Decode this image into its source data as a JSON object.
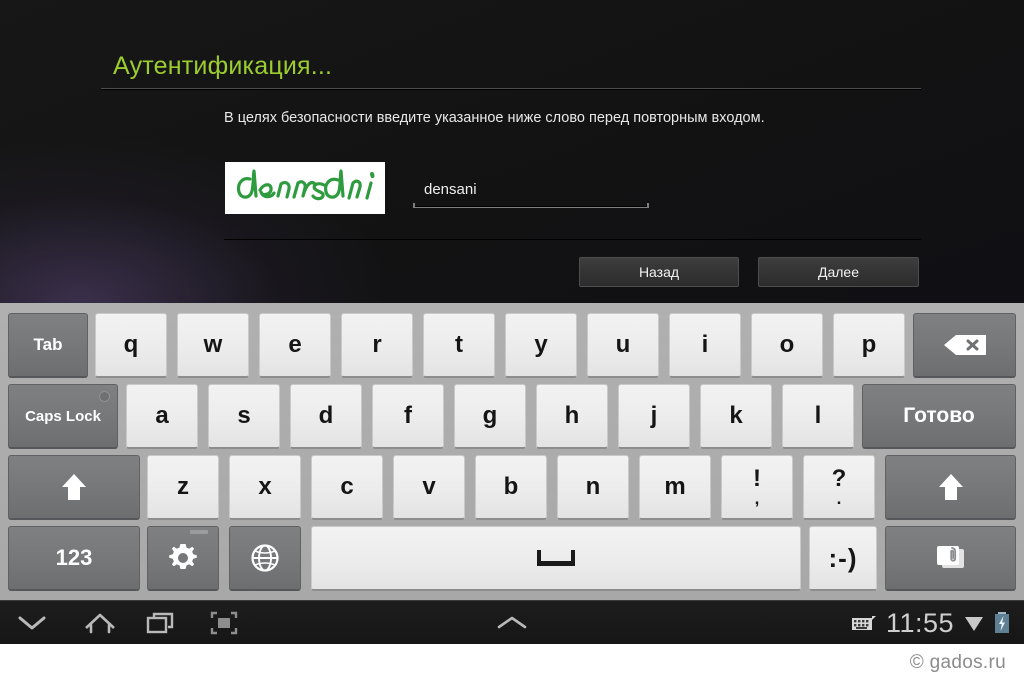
{
  "app": {
    "title": "Аутентификация...",
    "description": "В целях безопасности введите указанное ниже слово перед повторным входом.",
    "captcha": {
      "word": "densani",
      "color": "#2e9b3f",
      "background": "#ffffff"
    },
    "answer_input": {
      "value": "densani",
      "placeholder": ""
    },
    "buttons": {
      "back": "Назад",
      "next": "Далее"
    },
    "accent_color": "#9ccd2e"
  },
  "keyboard": {
    "rows": [
      {
        "keys": [
          {
            "label": "Tab",
            "name": "key-tab",
            "style": "dark"
          },
          {
            "label": "q",
            "name": "key-q",
            "style": "light"
          },
          {
            "label": "w",
            "name": "key-w",
            "style": "light"
          },
          {
            "label": "e",
            "name": "key-e",
            "style": "light"
          },
          {
            "label": "r",
            "name": "key-r",
            "style": "light"
          },
          {
            "label": "t",
            "name": "key-t",
            "style": "light"
          },
          {
            "label": "y",
            "name": "key-y",
            "style": "light"
          },
          {
            "label": "u",
            "name": "key-u",
            "style": "light"
          },
          {
            "label": "i",
            "name": "key-i",
            "style": "light"
          },
          {
            "label": "o",
            "name": "key-o",
            "style": "light"
          },
          {
            "label": "p",
            "name": "key-p",
            "style": "light"
          },
          {
            "label": "",
            "name": "key-backspace",
            "style": "dark",
            "icon": "backspace-icon"
          }
        ]
      },
      {
        "keys": [
          {
            "label": "Caps Lock",
            "name": "key-caps-lock",
            "style": "dark"
          },
          {
            "label": "a",
            "name": "key-a",
            "style": "light"
          },
          {
            "label": "s",
            "name": "key-s",
            "style": "light"
          },
          {
            "label": "d",
            "name": "key-d",
            "style": "light"
          },
          {
            "label": "f",
            "name": "key-f",
            "style": "light"
          },
          {
            "label": "g",
            "name": "key-g",
            "style": "light"
          },
          {
            "label": "h",
            "name": "key-h",
            "style": "light"
          },
          {
            "label": "j",
            "name": "key-j",
            "style": "light"
          },
          {
            "label": "k",
            "name": "key-k",
            "style": "light"
          },
          {
            "label": "l",
            "name": "key-l",
            "style": "light"
          },
          {
            "label": "Готово",
            "name": "key-done",
            "style": "dark"
          }
        ]
      },
      {
        "keys": [
          {
            "label": "",
            "name": "key-shift-left",
            "style": "dark",
            "icon": "shift-up-icon"
          },
          {
            "label": "z",
            "name": "key-z",
            "style": "light"
          },
          {
            "label": "x",
            "name": "key-x",
            "style": "light"
          },
          {
            "label": "c",
            "name": "key-c",
            "style": "light"
          },
          {
            "label": "v",
            "name": "key-v",
            "style": "light"
          },
          {
            "label": "b",
            "name": "key-b",
            "style": "light"
          },
          {
            "label": "n",
            "name": "key-n",
            "style": "light"
          },
          {
            "label": "m",
            "name": "key-m",
            "style": "light"
          },
          {
            "label": "!",
            "sub": ",",
            "name": "key-exclam-comma",
            "style": "light"
          },
          {
            "label": "?",
            "sub": ".",
            "name": "key-question-period",
            "style": "light"
          },
          {
            "label": "",
            "name": "key-shift-right",
            "style": "dark",
            "icon": "shift-up-icon"
          }
        ]
      },
      {
        "keys": [
          {
            "label": "123",
            "name": "key-numbers",
            "style": "dark"
          },
          {
            "label": "",
            "name": "key-settings",
            "style": "dark",
            "icon": "gear-icon"
          },
          {
            "label": "",
            "name": "key-language",
            "style": "dark",
            "icon": "globe-icon"
          },
          {
            "label": "",
            "name": "key-space",
            "style": "light",
            "icon": "space-icon"
          },
          {
            "label": ":-)",
            "name": "key-emoticon",
            "style": "light"
          },
          {
            "label": "",
            "name": "key-clipboard",
            "style": "dark",
            "icon": "clipboard-icon"
          }
        ]
      }
    ]
  },
  "navbar": {
    "hide_keyboard": "hide-keyboard-icon",
    "home": "home-icon",
    "recents": "recents-icon",
    "screenshot": "screenshot-icon",
    "expand": "chevron-up-icon",
    "status": {
      "keyboard_indicator": "keyboard-icon",
      "clock": "11:55",
      "wifi": "wifi-icon",
      "battery": "battery-charging-icon"
    }
  },
  "watermark": "© gados.ru"
}
